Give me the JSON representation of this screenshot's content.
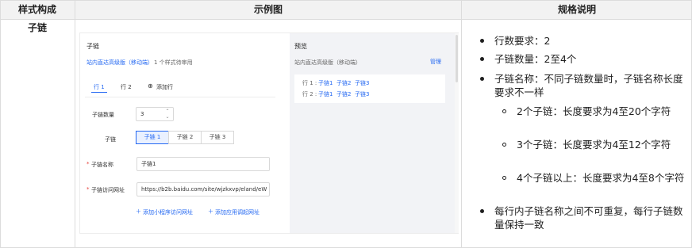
{
  "table": {
    "headers": [
      "样式构成",
      "示例图",
      "规格说明"
    ],
    "row_label": "子链"
  },
  "example": {
    "left": {
      "title": "子链",
      "subtitle_main": "站内直达高级版（移动端）",
      "subtitle_tail": "1 个样式待审用",
      "tabs": [
        "行 1",
        "行 2"
      ],
      "add_row": "添加行",
      "count_label": "子链数量",
      "count_value": "3",
      "chain_label": "子链",
      "chain_options": [
        "子链 1",
        "子链 2",
        "子链 3"
      ],
      "name_label": "子链名称",
      "name_value": "子链1",
      "url_label": "子链访问网址",
      "url_value": "https://b2b.baidu.com/site/wjzkxvp/eland/eW",
      "link_mini": "添加小程序访问网址",
      "link_app": "添加应用调起网址"
    },
    "right": {
      "title": "预览",
      "subtitle": "站内直达高级版（移动端）",
      "manage": "管理",
      "row1_label": "行 1 :",
      "row2_label": "行 2 :",
      "chains": [
        "子链1",
        "子链2",
        "子链3"
      ]
    }
  },
  "spec": {
    "items": [
      "行数要求：2",
      "子链数量：2至4个",
      "子链名称：不同子链数量时，子链名称长度要求不一样",
      "每行内子链名称之间不可重复，每行子链数量保持一致"
    ],
    "sub_items": [
      "2个子链：长度要求为4至20个字符",
      "3个子链：长度要求为4至12个字符",
      "4个子链以上：长度要求为4至8个字符"
    ]
  }
}
